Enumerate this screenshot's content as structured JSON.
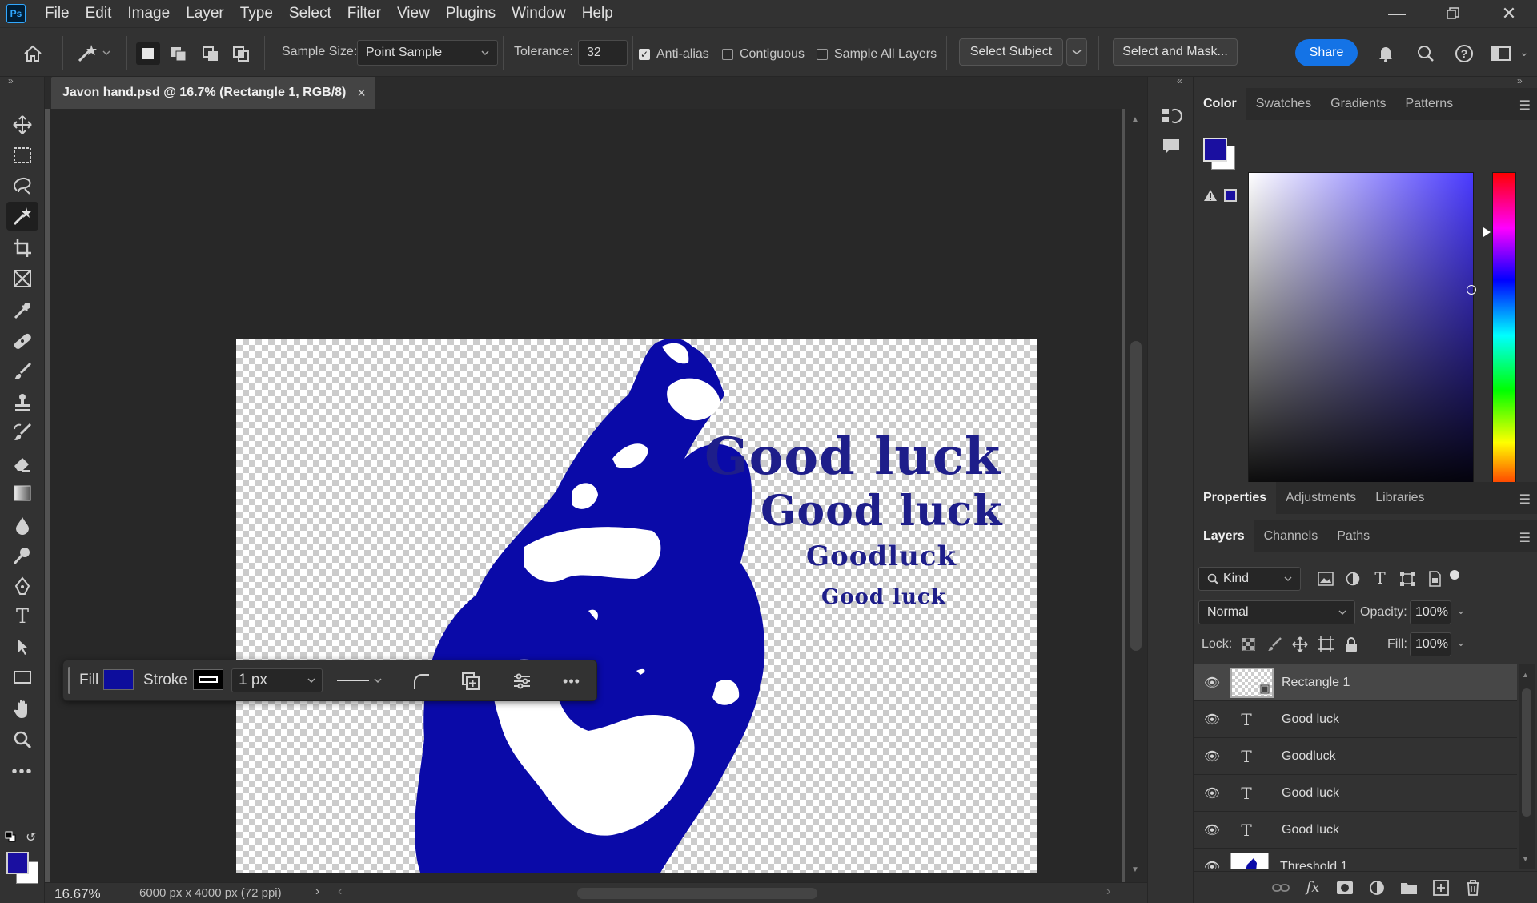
{
  "app": {
    "logo_text": "Ps"
  },
  "menu": [
    "File",
    "Edit",
    "Image",
    "Layer",
    "Type",
    "Select",
    "Filter",
    "View",
    "Plugins",
    "Window",
    "Help"
  ],
  "options": {
    "sample_size_label": "Sample Size:",
    "sample_size_value": "Point Sample",
    "tolerance_label": "Tolerance:",
    "tolerance_value": "32",
    "anti_alias_label": "Anti-alias",
    "anti_alias_checked": true,
    "contiguous_label": "Contiguous",
    "contiguous_checked": false,
    "sample_all_label": "Sample All Layers",
    "sample_all_checked": false,
    "select_subject_label": "Select Subject",
    "select_mask_label": "Select and Mask...",
    "share_label": "Share"
  },
  "tab": {
    "title": "Javon hand.psd @ 16.7% (Rectangle 1, RGB/8)",
    "close": "×"
  },
  "canvas": {
    "texts": [
      "Good luck",
      "Good luck",
      "Goodluck",
      "Good luck"
    ],
    "ink_color": "#0a0aa8"
  },
  "taskbar": {
    "fill_label": "Fill",
    "fill_color": "#0d0d9c",
    "stroke_label": "Stroke",
    "stroke_width": "1 px"
  },
  "status": {
    "zoom": "16.67%",
    "doc_info": "6000 px x 4000 px (72 ppi)"
  },
  "color_panel": {
    "tabs": [
      "Color",
      "Swatches",
      "Gradients",
      "Patterns"
    ],
    "foreground": "#1a0fa0",
    "background": "#ffffff"
  },
  "properties_panel": {
    "tabs": [
      "Properties",
      "Adjustments",
      "Libraries"
    ]
  },
  "layers_panel": {
    "tabs": [
      "Layers",
      "Channels",
      "Paths"
    ],
    "filter_kind": "Kind",
    "blend_mode": "Normal",
    "opacity_label": "Opacity:",
    "opacity_value": "100%",
    "lock_label": "Lock:",
    "fill_label": "Fill:",
    "fill_value": "100%",
    "layers": [
      {
        "name": "Rectangle 1",
        "type": "shape",
        "visible": true,
        "selected": true
      },
      {
        "name": "Good luck",
        "type": "text",
        "visible": true,
        "selected": false
      },
      {
        "name": "Goodluck",
        "type": "text",
        "visible": true,
        "selected": false
      },
      {
        "name": "Good luck",
        "type": "text",
        "visible": true,
        "selected": false
      },
      {
        "name": "Good luck",
        "type": "text",
        "visible": true,
        "selected": false
      },
      {
        "name": "Threshold 1",
        "type": "adjustment",
        "visible": true,
        "selected": false
      }
    ]
  }
}
